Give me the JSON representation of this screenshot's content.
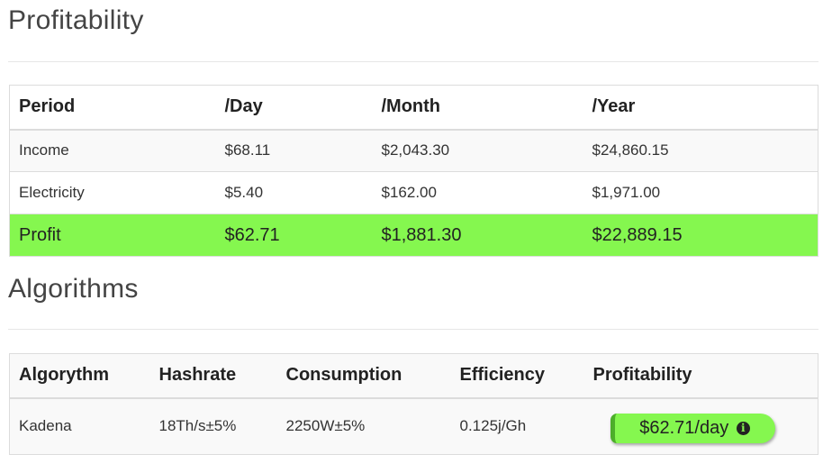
{
  "profitability": {
    "title": "Profitability",
    "headers": [
      "Period",
      "/Day",
      "/Month",
      "/Year"
    ],
    "rows": [
      {
        "label": "Income",
        "day": "$68.11",
        "month": "$2,043.30",
        "year": "$24,860.15"
      },
      {
        "label": "Electricity",
        "day": "$5.40",
        "month": "$162.00",
        "year": "$1,971.00"
      },
      {
        "label": "Profit",
        "day": "$62.71",
        "month": "$1,881.30",
        "year": "$22,889.15"
      }
    ],
    "highlight_color": "#85f74f"
  },
  "algorithms": {
    "title": "Algorithms",
    "headers": [
      "Algorythm",
      "Hashrate",
      "Consumption",
      "Efficiency",
      "Profitability"
    ],
    "rows": [
      {
        "algorithm": "Kadena",
        "hashrate": "18Th/s±5%",
        "consumption": "2250W±5%",
        "efficiency": "0.125j/Gh",
        "profitability": "$62.71/day",
        "profitability_icon": "info-circle-icon"
      }
    ]
  }
}
